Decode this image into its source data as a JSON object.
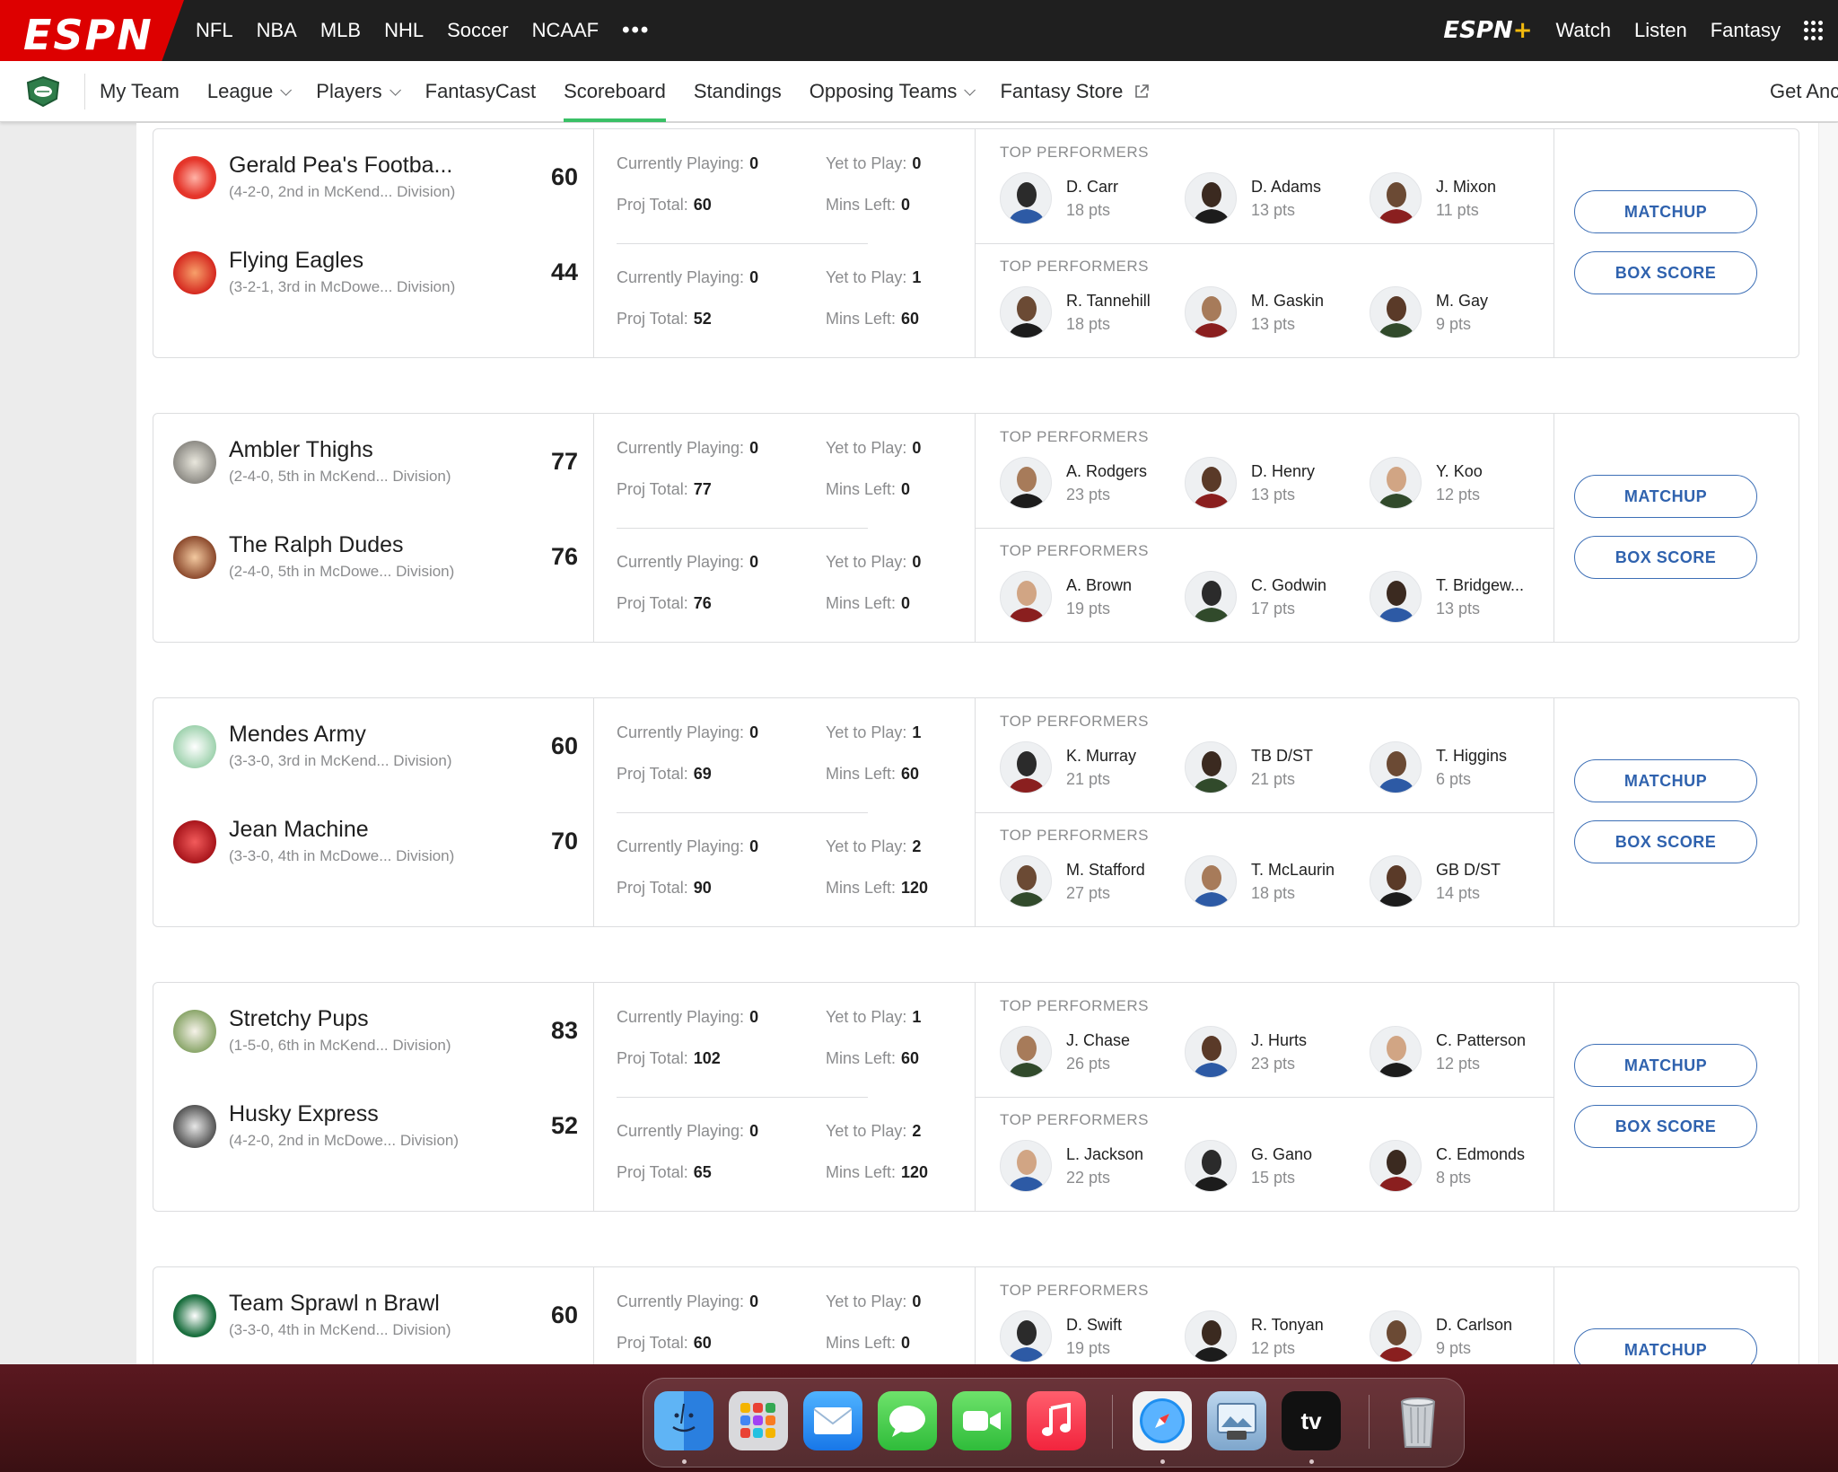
{
  "topnav": {
    "brand": "ESPN",
    "links": [
      "NFL",
      "NBA",
      "MLB",
      "NHL",
      "Soccer",
      "NCAAF"
    ],
    "more": "•••",
    "right_links": [
      "Watch",
      "Listen",
      "Fantasy"
    ],
    "espn_plus_text": "ESPN",
    "espn_plus_mark": "+"
  },
  "subnav": {
    "items": [
      {
        "label": "My Team"
      },
      {
        "label": "League"
      },
      {
        "label": "Players"
      },
      {
        "label": "FantasyCast"
      },
      {
        "label": "Scoreboard"
      },
      {
        "label": "Standings"
      },
      {
        "label": "Opposing Teams"
      },
      {
        "label": "Fantasy Store"
      }
    ],
    "right": "Get Anc"
  },
  "labels": {
    "currently_playing": "Currently Playing:",
    "yet_to_play": "Yet to Play:",
    "proj_total": "Proj Total:",
    "mins_left": "Mins Left:",
    "top_performers": "TOP PERFORMERS",
    "matchup": "MATCHUP",
    "box_score": "BOX SCORE"
  },
  "matchups": [
    {
      "teams": [
        {
          "name": "Gerald Pea's Footba...",
          "record": "(4-2-0, 2nd in McKend... Division)",
          "score": "60",
          "stats": {
            "currently_playing": "0",
            "yet_to_play": "0",
            "proj_total": "60",
            "mins_left": "0"
          },
          "performers": [
            {
              "name": "D. Carr",
              "pts": "18 pts"
            },
            {
              "name": "D. Adams",
              "pts": "13 pts"
            },
            {
              "name": "J. Mixon",
              "pts": "11 pts"
            }
          ]
        },
        {
          "name": "Flying Eagles",
          "record": "(3-2-1, 3rd in McDowe... Division)",
          "score": "44",
          "stats": {
            "currently_playing": "0",
            "yet_to_play": "1",
            "proj_total": "52",
            "mins_left": "60"
          },
          "performers": [
            {
              "name": "R. Tannehill",
              "pts": "18 pts"
            },
            {
              "name": "M. Gaskin",
              "pts": "13 pts"
            },
            {
              "name": "M. Gay",
              "pts": "9 pts"
            }
          ]
        }
      ]
    },
    {
      "teams": [
        {
          "name": "Ambler Thighs",
          "record": "(2-4-0, 5th in McKend... Division)",
          "score": "77",
          "stats": {
            "currently_playing": "0",
            "yet_to_play": "0",
            "proj_total": "77",
            "mins_left": "0"
          },
          "performers": [
            {
              "name": "A. Rodgers",
              "pts": "23 pts"
            },
            {
              "name": "D. Henry",
              "pts": "13 pts"
            },
            {
              "name": "Y. Koo",
              "pts": "12 pts"
            }
          ]
        },
        {
          "name": "The Ralph Dudes",
          "record": "(2-4-0, 5th in McDowe... Division)",
          "score": "76",
          "stats": {
            "currently_playing": "0",
            "yet_to_play": "0",
            "proj_total": "76",
            "mins_left": "0"
          },
          "performers": [
            {
              "name": "A. Brown",
              "pts": "19 pts"
            },
            {
              "name": "C. Godwin",
              "pts": "17 pts"
            },
            {
              "name": "T. Bridgew...",
              "pts": "13 pts"
            }
          ]
        }
      ]
    },
    {
      "teams": [
        {
          "name": "Mendes Army",
          "record": "(3-3-0, 3rd in McKend... Division)",
          "score": "60",
          "stats": {
            "currently_playing": "0",
            "yet_to_play": "1",
            "proj_total": "69",
            "mins_left": "60"
          },
          "performers": [
            {
              "name": "K. Murray",
              "pts": "21 pts"
            },
            {
              "name": "TB D/ST",
              "pts": "21 pts"
            },
            {
              "name": "T. Higgins",
              "pts": "6 pts"
            }
          ]
        },
        {
          "name": "Jean Machine",
          "record": "(3-3-0, 4th in McDowe... Division)",
          "score": "70",
          "stats": {
            "currently_playing": "0",
            "yet_to_play": "2",
            "proj_total": "90",
            "mins_left": "120"
          },
          "performers": [
            {
              "name": "M. Stafford",
              "pts": "27 pts"
            },
            {
              "name": "T. McLaurin",
              "pts": "18 pts"
            },
            {
              "name": "GB D/ST",
              "pts": "14 pts"
            }
          ]
        }
      ]
    },
    {
      "teams": [
        {
          "name": "Stretchy Pups",
          "record": "(1-5-0, 6th in McKend... Division)",
          "score": "83",
          "stats": {
            "currently_playing": "0",
            "yet_to_play": "1",
            "proj_total": "102",
            "mins_left": "60"
          },
          "performers": [
            {
              "name": "J. Chase",
              "pts": "26 pts"
            },
            {
              "name": "J. Hurts",
              "pts": "23 pts"
            },
            {
              "name": "C. Patterson",
              "pts": "12 pts"
            }
          ]
        },
        {
          "name": "Husky Express",
          "record": "(4-2-0, 2nd in McDowe... Division)",
          "score": "52",
          "stats": {
            "currently_playing": "0",
            "yet_to_play": "2",
            "proj_total": "65",
            "mins_left": "120"
          },
          "performers": [
            {
              "name": "L. Jackson",
              "pts": "22 pts"
            },
            {
              "name": "G. Gano",
              "pts": "15 pts"
            },
            {
              "name": "C. Edmonds",
              "pts": "8 pts"
            }
          ]
        }
      ]
    },
    {
      "teams": [
        {
          "name": "Team Sprawl n Brawl",
          "record": "(3-3-0, 4th in McKend... Division)",
          "score": "60",
          "stats": {
            "currently_playing": "0",
            "yet_to_play": "0",
            "proj_total": "60",
            "mins_left": "0"
          },
          "performers": [
            {
              "name": "D. Swift",
              "pts": "19 pts"
            },
            {
              "name": "R. Tonyan",
              "pts": "12 pts"
            },
            {
              "name": "D. Carlson",
              "pts": "9 pts"
            }
          ]
        }
      ]
    }
  ],
  "dock": {
    "apps": [
      "finder-icon",
      "launchpad-icon",
      "mail-icon",
      "messages-icon",
      "facetime-icon",
      "music-icon",
      "safari-icon",
      "preview-icon",
      "appletv-icon",
      "trash-icon"
    ],
    "appletv_label": "tv"
  },
  "colors": {
    "espn_red": "#dd0000",
    "topnav_bg": "#1f1f1f",
    "active_tab": "#3ac066",
    "button_blue": "#2f62ae"
  }
}
